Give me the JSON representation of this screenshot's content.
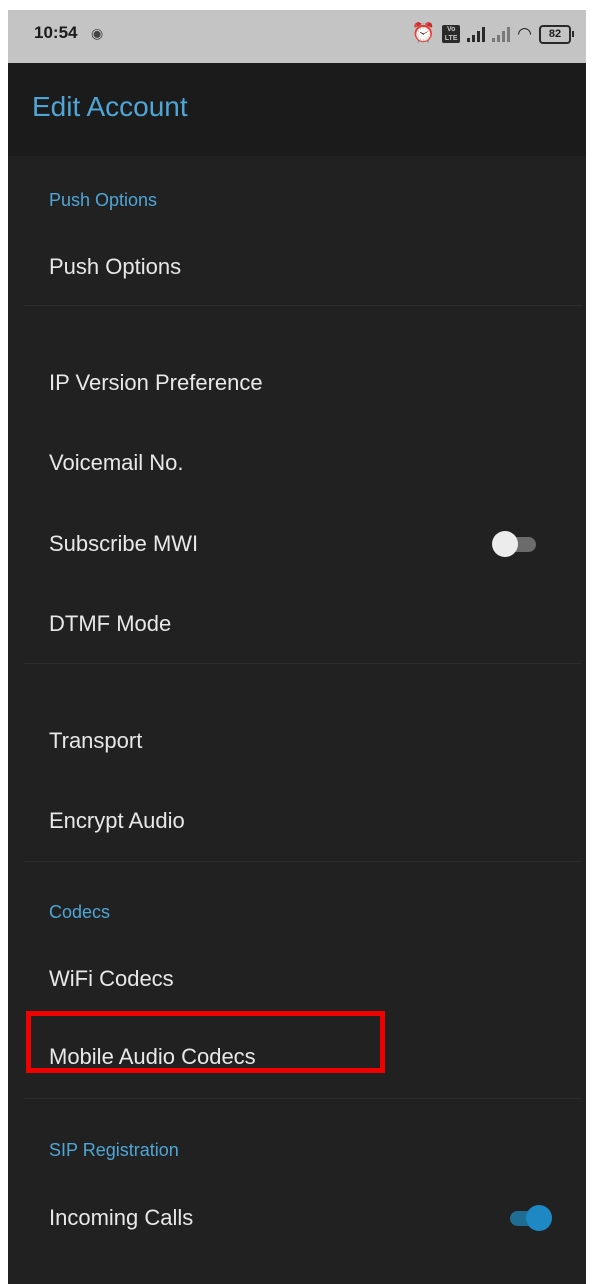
{
  "status_bar": {
    "time": "10:54",
    "battery_level": "82",
    "icons": [
      "hotspot-icon",
      "alarm-icon",
      "volte-icon",
      "signal-icon",
      "signal-weak-icon",
      "wifi-icon",
      "battery-icon"
    ]
  },
  "app_bar": {
    "title": "Edit Account"
  },
  "sections": {
    "push": {
      "header": "Push Options",
      "items": [
        "Push Options"
      ]
    },
    "network": {
      "items": [
        "IP Version Preference",
        "Voicemail No.",
        "Subscribe MWI",
        "DTMF Mode"
      ]
    },
    "transport": {
      "items": [
        "Transport",
        "Encrypt Audio"
      ]
    },
    "codecs": {
      "header": "Codecs",
      "items": [
        "WiFi Codecs",
        "Mobile Audio Codecs"
      ]
    },
    "sip": {
      "header": "SIP Registration",
      "items": [
        "Incoming Calls"
      ]
    }
  },
  "toggles": {
    "subscribe_mwi": false,
    "incoming_calls": true
  },
  "colors": {
    "accent": "#4fa6d6",
    "background": "#212121",
    "status_bar": "#c4c4c4",
    "highlight": "#f00000",
    "toggle_on": "#1e88c5"
  }
}
